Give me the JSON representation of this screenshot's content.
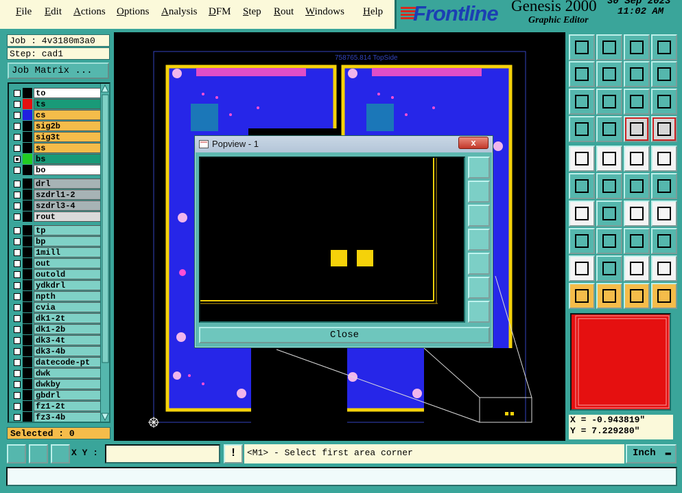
{
  "menu": [
    "File",
    "Edit",
    "Actions",
    "Options",
    "Analysis",
    "DFM",
    "Step",
    "Rout",
    "Windows",
    "Help"
  ],
  "brand": {
    "logo": "Frontline",
    "product": "Genesis 2000",
    "subtitle": "Graphic Editor",
    "date": "30 Sep 2023",
    "time": "11:02 AM"
  },
  "job": {
    "job_label": "Job : 4v3180m3a0",
    "step_label": "Step: cad1",
    "matrix_button": "Job Matrix ..."
  },
  "layers": [
    {
      "name": "to",
      "color": "#000000",
      "bg": "#ffffff",
      "checked": false
    },
    {
      "name": "ts",
      "color": "#e51010",
      "bg": "#199a78",
      "checked": false
    },
    {
      "name": "cs",
      "color": "#2020e0",
      "bg": "#f5bc4a",
      "checked": false
    },
    {
      "name": "sig2b",
      "color": "#000000",
      "bg": "#f5bc4a",
      "checked": false
    },
    {
      "name": "sig3t",
      "color": "#000000",
      "bg": "#f5bc4a",
      "checked": false
    },
    {
      "name": "ss",
      "color": "#000000",
      "bg": "#f5bc4a",
      "checked": false
    },
    {
      "name": "bs",
      "color": "#22cc22",
      "bg": "#199a78",
      "checked": true
    },
    {
      "name": "bo",
      "color": "#000000",
      "bg": "#ffffff",
      "checked": false
    },
    {
      "name": "drl",
      "color": "#000000",
      "bg": "#a7b3b5",
      "checked": false
    },
    {
      "name": "szdrl1-2",
      "color": "#000000",
      "bg": "#a7b3b5",
      "checked": false
    },
    {
      "name": "szdrl3-4",
      "color": "#000000",
      "bg": "#a7b3b5",
      "checked": false
    },
    {
      "name": "rout",
      "color": "#000000",
      "bg": "#dadada",
      "checked": false
    },
    {
      "name": "tp",
      "color": "#000000",
      "bg": "#7fd1c6",
      "checked": false
    },
    {
      "name": "bp",
      "color": "#000000",
      "bg": "#7fd1c6",
      "checked": false
    },
    {
      "name": "1mill",
      "color": "#000000",
      "bg": "#7fd1c6",
      "checked": false
    },
    {
      "name": "out",
      "color": "#000000",
      "bg": "#7fd1c6",
      "checked": false
    },
    {
      "name": "outold",
      "color": "#000000",
      "bg": "#7fd1c6",
      "checked": false
    },
    {
      "name": "ydkdrl",
      "color": "#000000",
      "bg": "#7fd1c6",
      "checked": false
    },
    {
      "name": "npth",
      "color": "#000000",
      "bg": "#7fd1c6",
      "checked": false
    },
    {
      "name": "cvia",
      "color": "#000000",
      "bg": "#7fd1c6",
      "checked": false
    },
    {
      "name": "dk1-2t",
      "color": "#000000",
      "bg": "#7fd1c6",
      "checked": false
    },
    {
      "name": "dk1-2b",
      "color": "#000000",
      "bg": "#7fd1c6",
      "checked": false
    },
    {
      "name": "dk3-4t",
      "color": "#000000",
      "bg": "#7fd1c6",
      "checked": false
    },
    {
      "name": "dk3-4b",
      "color": "#000000",
      "bg": "#7fd1c6",
      "checked": false
    },
    {
      "name": "datecode-pt",
      "color": "#000000",
      "bg": "#7fd1c6",
      "checked": false
    },
    {
      "name": "dwk",
      "color": "#000000",
      "bg": "#7fd1c6",
      "checked": false
    },
    {
      "name": "dwkby",
      "color": "#000000",
      "bg": "#7fd1c6",
      "checked": false
    },
    {
      "name": "gbdrl",
      "color": "#000000",
      "bg": "#7fd1c6",
      "checked": false
    },
    {
      "name": "fz1-2t",
      "color": "#000000",
      "bg": "#7fd1c6",
      "checked": false
    },
    {
      "name": "fz3-4b",
      "color": "#000000",
      "bg": "#7fd1c6",
      "checked": false
    }
  ],
  "selected": "Selected : 0",
  "canvas": {
    "board_label": "758765.814 TopSide"
  },
  "popview": {
    "title": "Popview - 1",
    "close_x": "x",
    "close_button": "Close"
  },
  "coords": {
    "x": "X = -0.943819\"",
    "y": "Y = 7.229280\""
  },
  "bottom": {
    "xy_label": "X Y :",
    "xy_value": "",
    "warn": "!",
    "message": "<M1> - Select first area corner",
    "units": "Inch"
  },
  "toolbar_icons": [
    "zoom-home",
    "zoom-fit",
    "home",
    "window",
    "pan-left",
    "pan-right",
    "undo",
    "redo",
    "center",
    "zoom",
    "one-to-one",
    "help",
    "filter",
    "grid",
    "snap-a",
    "snap-b",
    "select-pad",
    "draw-line",
    "ruler",
    "circle",
    "net",
    "cross",
    "move",
    "move-copy",
    "angle-line",
    "line",
    "arc",
    "dual-f",
    "feature",
    "resize",
    "measure",
    "cut",
    "triangle-a",
    "triangle-b",
    "triangle-c",
    "triangle-d",
    "pointer",
    "pointer-box",
    "pointer-circle",
    "route"
  ]
}
